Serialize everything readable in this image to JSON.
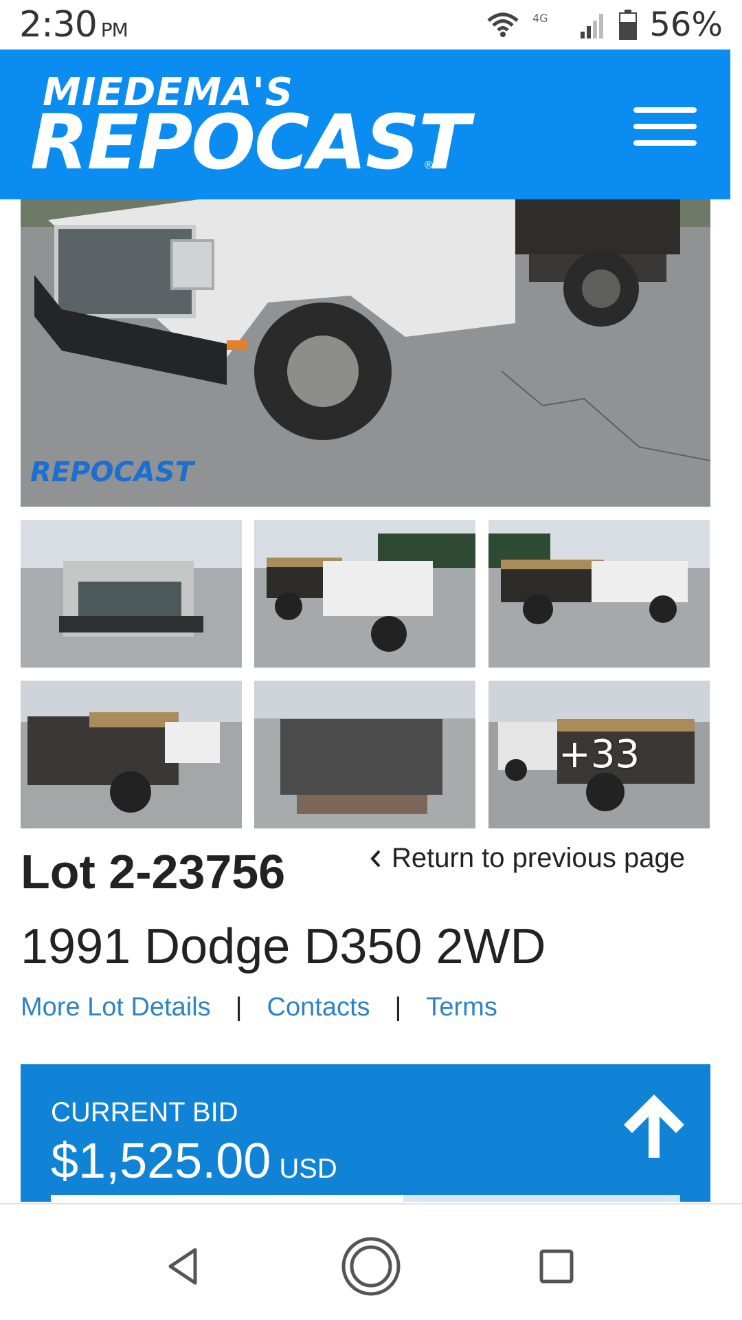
{
  "status_bar": {
    "time": "2:30",
    "ampm": "PM",
    "network": "4G",
    "battery": "56%"
  },
  "header": {
    "logo_top": "MIEDEMA'S",
    "logo_main": "REPOCAST",
    "logo_reg": "®",
    "menu_icon": "hamburger-menu-icon"
  },
  "gallery": {
    "main_image": "1991 Dodge D350 white dump truck, front three-quarter view",
    "main_watermark": "REPOCAST",
    "more_photos_label": "+33"
  },
  "lot": {
    "number": "Lot 2-23756",
    "return_label": "Return to previous page",
    "title": "1991 Dodge D350 2WD",
    "links": [
      "More Lot Details",
      "Contacts",
      "Terms"
    ],
    "link_separator": "|"
  },
  "bid": {
    "label": "CURRENT BID",
    "amount": "$1,525.00",
    "currency": "USD",
    "progress": 0.56
  },
  "colors": {
    "header_blue": "#0a8cf0",
    "bid_blue": "#1083d6",
    "link_blue": "#2f83c4"
  }
}
